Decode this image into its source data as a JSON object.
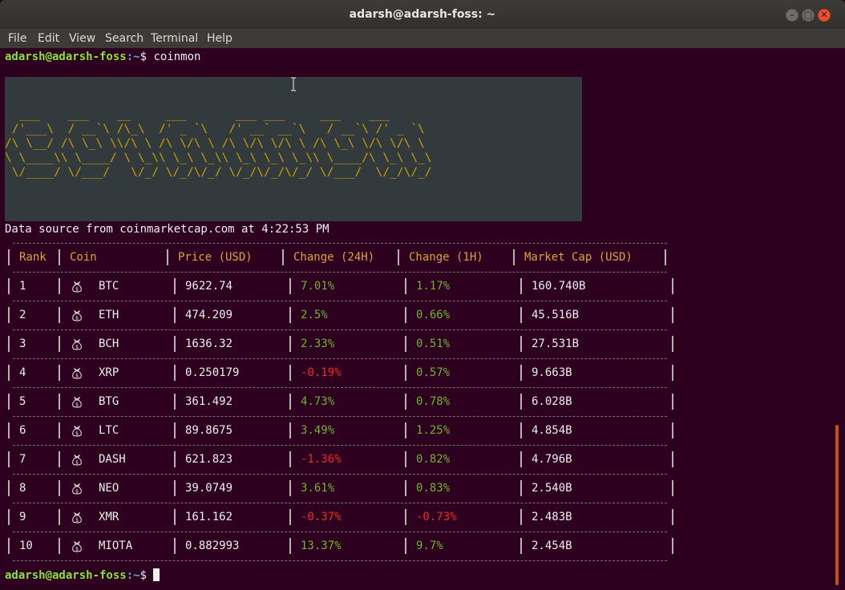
{
  "window": {
    "title": "adarsh@adarsh-foss: ~",
    "controls": {
      "minimize": "–",
      "maximize": "□",
      "close": "✕"
    }
  },
  "menu": [
    "File",
    "Edit",
    "View",
    "Search",
    "Terminal",
    "Help"
  ],
  "prompt": {
    "user": "adarsh@adarsh-foss",
    "path": ":~",
    "symbol": "$"
  },
  "command": "coinmon",
  "banner_art": "  ___    ___    __     ___       ___ ___     ___    ___\n /'___\\  / __`\\ /\\_\\  /' _ `\\   /' __` __`\\   / __`\\ /' _ `\\\n/\\ \\__/ /\\ \\_\\ \\\\/\\ \\ /\\ \\/\\ \\ /\\ \\/\\ \\/\\ \\ /\\ \\_\\ \\/\\ \\/\\ \\\n\\ \\____\\\\ \\____/ \\ \\_\\\\ \\_\\ \\_\\\\ \\_\\ \\_\\ \\_\\\\ \\____/\\ \\_\\ \\_\\\n \\/____/ \\/___/   \\/_/ \\/_/\\/_/ \\/_/\\/_/\\/_/ \\/___/  \\/_/\\/_/",
  "data_source": "Data source from coinmarketcap.com at 4:22:53 PM",
  "table": {
    "headers": [
      "Rank",
      "Coin",
      "Price (USD)",
      "Change (24H)",
      "Change (1H)",
      "Market Cap (USD)"
    ],
    "coin_icon": "money-bag-icon",
    "rows": [
      {
        "rank": "1",
        "coin": "BTC",
        "price": "9622.74",
        "change24h": "7.01%",
        "change1h": "1.17%",
        "mcap": "160.740B"
      },
      {
        "rank": "2",
        "coin": "ETH",
        "price": "474.209",
        "change24h": "2.5%",
        "change1h": "0.66%",
        "mcap": "45.516B"
      },
      {
        "rank": "3",
        "coin": "BCH",
        "price": "1636.32",
        "change24h": "2.33%",
        "change1h": "0.51%",
        "mcap": "27.531B"
      },
      {
        "rank": "4",
        "coin": "XRP",
        "price": "0.250179",
        "change24h": "-0.19%",
        "change1h": "0.57%",
        "mcap": "9.663B"
      },
      {
        "rank": "5",
        "coin": "BTG",
        "price": "361.492",
        "change24h": "4.73%",
        "change1h": "0.78%",
        "mcap": "6.028B"
      },
      {
        "rank": "6",
        "coin": "LTC",
        "price": "89.8675",
        "change24h": "3.49%",
        "change1h": "1.25%",
        "mcap": "4.854B"
      },
      {
        "rank": "7",
        "coin": "DASH",
        "price": "621.823",
        "change24h": "-1.36%",
        "change1h": "0.82%",
        "mcap": "4.796B"
      },
      {
        "rank": "8",
        "coin": "NEO",
        "price": "39.0749",
        "change24h": "3.61%",
        "change1h": "0.83%",
        "mcap": "2.540B"
      },
      {
        "rank": "9",
        "coin": "XMR",
        "price": "161.162",
        "change24h": "-0.37%",
        "change1h": "-0.73%",
        "mcap": "2.483B"
      },
      {
        "rank": "10",
        "coin": "MIOTA",
        "price": "0.882993",
        "change24h": "13.37%",
        "change1h": "9.7%",
        "mcap": "2.454B"
      }
    ]
  },
  "colors": {
    "background": "#2c001e",
    "prompt_user": "#8ae234",
    "prompt_path": "#729fcf",
    "header": "#e1a13e",
    "positive": "#73b330",
    "negative": "#ef2929",
    "banner": "#c4a000"
  }
}
